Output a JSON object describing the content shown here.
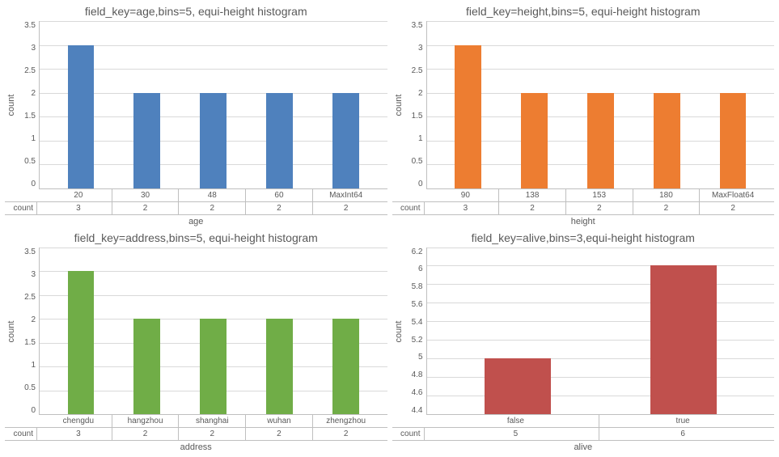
{
  "chart_data": [
    {
      "id": "age",
      "type": "bar",
      "title": "field_key=age,bins=5, equi-height histogram",
      "xlabel": "age",
      "ylabel": "count",
      "series_name": "count",
      "color": "c-blue",
      "ylim": [
        0,
        3.5
      ],
      "yticks": [
        "3.5",
        "3",
        "2.5",
        "2",
        "1.5",
        "1",
        "0.5",
        "0"
      ],
      "categories": [
        "20",
        "30",
        "48",
        "60",
        "MaxInt64"
      ],
      "values": [
        3,
        2,
        2,
        2,
        2
      ]
    },
    {
      "id": "height",
      "type": "bar",
      "title": "field_key=height,bins=5, equi-height histogram",
      "xlabel": "height",
      "ylabel": "count",
      "series_name": "count",
      "color": "c-orange",
      "ylim": [
        0,
        3.5
      ],
      "yticks": [
        "3.5",
        "3",
        "2.5",
        "2",
        "1.5",
        "1",
        "0.5",
        "0"
      ],
      "categories": [
        "90",
        "138",
        "153",
        "180",
        "MaxFloat64"
      ],
      "values": [
        3,
        2,
        2,
        2,
        2
      ]
    },
    {
      "id": "address",
      "type": "bar",
      "title": "field_key=address,bins=5, equi-height histogram",
      "xlabel": "address",
      "ylabel": "count",
      "series_name": "count",
      "color": "c-green",
      "ylim": [
        0,
        3.5
      ],
      "yticks": [
        "3.5",
        "3",
        "2.5",
        "2",
        "1.5",
        "1",
        "0.5",
        "0"
      ],
      "categories": [
        "chengdu",
        "hangzhou",
        "shanghai",
        "wuhan",
        "zhengzhou"
      ],
      "values": [
        3,
        2,
        2,
        2,
        2
      ]
    },
    {
      "id": "alive",
      "type": "bar",
      "title": "field_key=alive,bins=3,equi-height histogram",
      "xlabel": "alive",
      "ylabel": "count",
      "series_name": "count",
      "color": "c-red",
      "ylim": [
        4.4,
        6.2
      ],
      "yticks": [
        "6.2",
        "6",
        "5.8",
        "5.6",
        "5.4",
        "5.2",
        "5",
        "4.8",
        "4.6",
        "4.4"
      ],
      "categories": [
        "false",
        "true"
      ],
      "values": [
        5,
        6
      ]
    }
  ]
}
